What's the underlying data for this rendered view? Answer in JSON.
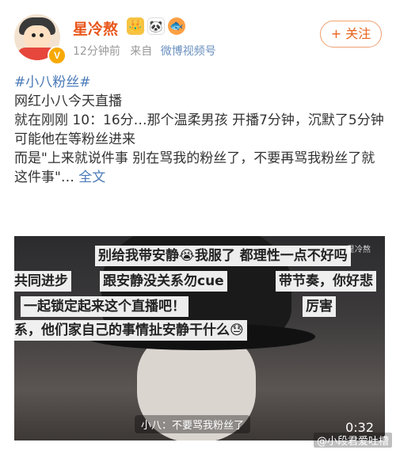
{
  "header": {
    "username": "星冷熬",
    "badges": [
      "👑",
      "🐼",
      "🐟"
    ],
    "time": "12分钟前",
    "from_label": "来自",
    "source": "微博视频号",
    "follow_label": "+ 关注",
    "verified_mark": "V"
  },
  "post": {
    "hashtag": "#小八粉丝#",
    "lines": [
      "网红小八今天直播",
      "就在刚刚 10：16分…那个温柔男孩 开播7分钟，沉默了5分钟",
      "可能他在等粉丝进来"
    ],
    "last_line": "而是\"上来就说件事  别在骂我的粉丝了，不要再骂我粉丝了就这件事\"…",
    "more_label": "全文"
  },
  "video": {
    "danmu": [
      "别给我带安静😭我服了 都理性一点不好吗",
      "共同进步",
      "跟安静没关系勿cue",
      "带节奏，你好悲",
      "一起锁定起来这个直播吧！",
      "厉害",
      "系，他们家自己的事情扯安静干什么😓"
    ],
    "corner_tag": "@星冷熬",
    "subtitle": "小八：不要骂我粉丝了",
    "duration": "0:32"
  },
  "watermark": "@小段君爱吐槽"
}
